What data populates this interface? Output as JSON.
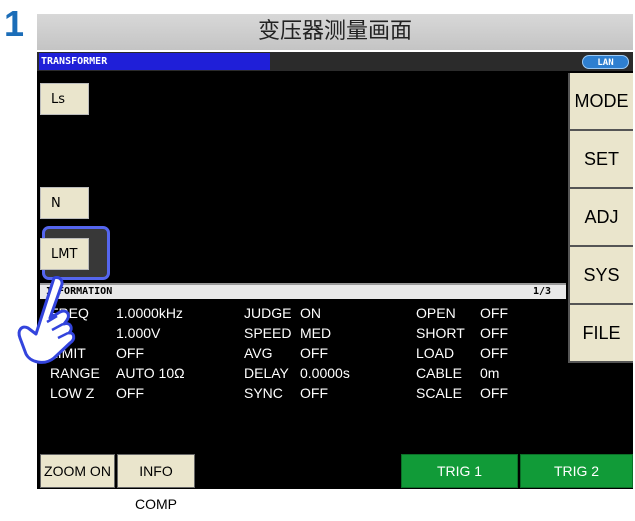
{
  "step_number": "1",
  "caption": "变压器测量画面",
  "header": {
    "mode_title": "TRANSFORMER",
    "lan_label": "LAN"
  },
  "left_buttons": {
    "ls": "Ls",
    "n": "N",
    "lmt": "LMT"
  },
  "right_menu": [
    "MODE",
    "SET",
    "ADJ",
    "SYS",
    "FILE"
  ],
  "info_panel": {
    "title": "INFORMATION",
    "page": "1/3",
    "rows": [
      [
        [
          "FREQ",
          "1.0000kHz"
        ],
        [
          "JUDGE",
          "ON"
        ],
        [
          "OPEN",
          "OFF"
        ]
      ],
      [
        [
          "V",
          "1.000V"
        ],
        [
          "SPEED",
          "MED"
        ],
        [
          "SHORT",
          "OFF"
        ]
      ],
      [
        [
          "LIMIT",
          "OFF"
        ],
        [
          "AVG",
          "OFF"
        ],
        [
          "LOAD",
          "OFF"
        ]
      ],
      [
        [
          "RANGE",
          "AUTO    10Ω"
        ],
        [
          "DELAY",
          "0.0000s"
        ],
        [
          "CABLE",
          "0m"
        ]
      ],
      [
        [
          "LOW Z",
          "OFF"
        ],
        [
          "SYNC",
          "OFF"
        ],
        [
          "SCALE",
          "OFF"
        ]
      ]
    ]
  },
  "bottom_buttons": {
    "zoom": "ZOOM ON",
    "info_comp": "INFO COMP",
    "trig1": "TRIG 1",
    "trig2": "TRIG 2"
  },
  "colors": {
    "accent_blue": "#1f1fd8",
    "trigger_green": "#119b38",
    "button_beige": "#eae5cc"
  },
  "icons": {
    "pointer": "hand-pointer-icon"
  }
}
